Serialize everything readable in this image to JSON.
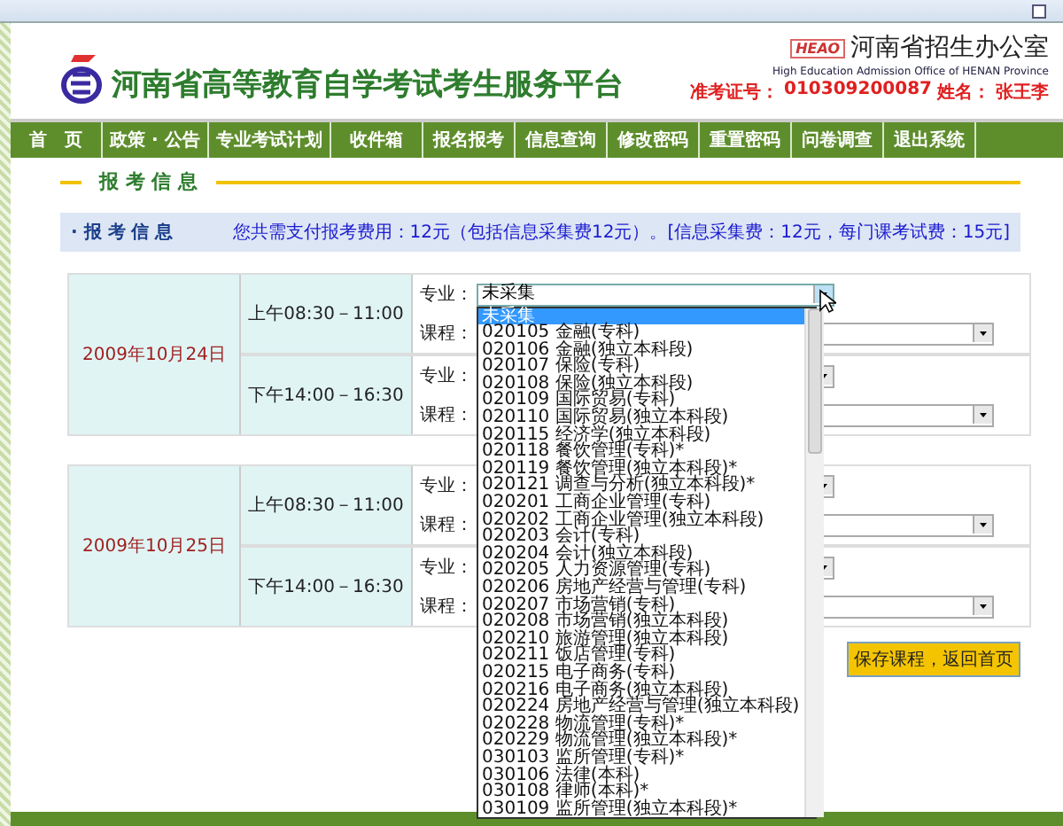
{
  "header": {
    "title": "河南省高等教育自学考试考生服务平台",
    "office_logo": "HEAO",
    "office_name": "河南省招生办公室",
    "office_name_en": "High Education Admission Office of HENAN Province",
    "ticket_label": "准考证号：",
    "ticket_number": "010309200087",
    "name_label": "姓名：",
    "name_value": "张王李"
  },
  "nav": [
    {
      "label": "首　页"
    },
    {
      "label": "政策 · 公告"
    },
    {
      "label": "专业考试计划"
    },
    {
      "label": "收件箱"
    },
    {
      "label": "报名报考"
    },
    {
      "label": "信息查询"
    },
    {
      "label": "修改密码"
    },
    {
      "label": "重置密码"
    },
    {
      "label": "问卷调查"
    },
    {
      "label": "退出系统"
    }
  ],
  "section_title": "报 考 信 息",
  "info_bar": {
    "title": "· 报 考 信 息",
    "fee_note": "您共需支付报考费用：12元（包括信息采集费12元）。[信息采集费：12元，每门课考试费：15元]"
  },
  "sessions": [
    {
      "date": "2009年10月24日",
      "slots": [
        {
          "time": "上午08:30－11:00",
          "major_label": "专业：",
          "major_value": "未采集",
          "course_label": "课程：",
          "open": true
        },
        {
          "time": "下午14:00－16:30",
          "major_label": "专业：",
          "course_label": "课程：",
          "open": false
        }
      ]
    },
    {
      "date": "2009年10月25日",
      "slots": [
        {
          "time": "上午08:30－11:00",
          "major_label": "专业：",
          "course_label": "课程：",
          "open": false
        },
        {
          "time": "下午14:00－16:30",
          "major_label": "专业：",
          "course_label": "课程：",
          "open": false
        }
      ]
    }
  ],
  "save_button": "保存课程，返回首页",
  "dropdown_options": [
    {
      "label": "未采集",
      "selected": true
    },
    {
      "label": "020105 金融(专科)",
      "selected": false
    },
    {
      "label": "020106 金融(独立本科段)",
      "selected": false
    },
    {
      "label": "020107 保险(专科)",
      "selected": false
    },
    {
      "label": "020108 保险(独立本科段)",
      "selected": false
    },
    {
      "label": "020109 国际贸易(专科)",
      "selected": false
    },
    {
      "label": "020110 国际贸易(独立本科段)",
      "selected": false
    },
    {
      "label": "020115 经济学(独立本科段)",
      "selected": false
    },
    {
      "label": "020118 餐饮管理(专科)*",
      "selected": false
    },
    {
      "label": "020119 餐饮管理(独立本科段)*",
      "selected": false
    },
    {
      "label": "020121 调查与分析(独立本科段)*",
      "selected": false
    },
    {
      "label": "020201 工商企业管理(专科)",
      "selected": false
    },
    {
      "label": "020202 工商企业管理(独立本科段)",
      "selected": false
    },
    {
      "label": "020203 会计(专科)",
      "selected": false
    },
    {
      "label": "020204 会计(独立本科段)",
      "selected": false
    },
    {
      "label": "020205 人力资源管理(专科)",
      "selected": false
    },
    {
      "label": "020206 房地产经营与管理(专科)",
      "selected": false
    },
    {
      "label": "020207 市场营销(专科)",
      "selected": false
    },
    {
      "label": "020208 市场营销(独立本科段)",
      "selected": false
    },
    {
      "label": "020210 旅游管理(独立本科段)",
      "selected": false
    },
    {
      "label": "020211 饭店管理(专科)",
      "selected": false
    },
    {
      "label": "020215 电子商务(专科)",
      "selected": false
    },
    {
      "label": "020216 电子商务(独立本科段)",
      "selected": false
    },
    {
      "label": "020224 房地产经营与管理(独立本科段)",
      "selected": false
    },
    {
      "label": "020228 物流管理(专科)*",
      "selected": false
    },
    {
      "label": "020229 物流管理(独立本科段)*",
      "selected": false
    },
    {
      "label": "030103 监所管理(专科)*",
      "selected": false
    },
    {
      "label": "030106 法律(本科)",
      "selected": false
    },
    {
      "label": "030108 律师(本科)*",
      "selected": false
    },
    {
      "label": "030109 监所管理(独立本科段)*",
      "selected": false
    }
  ]
}
